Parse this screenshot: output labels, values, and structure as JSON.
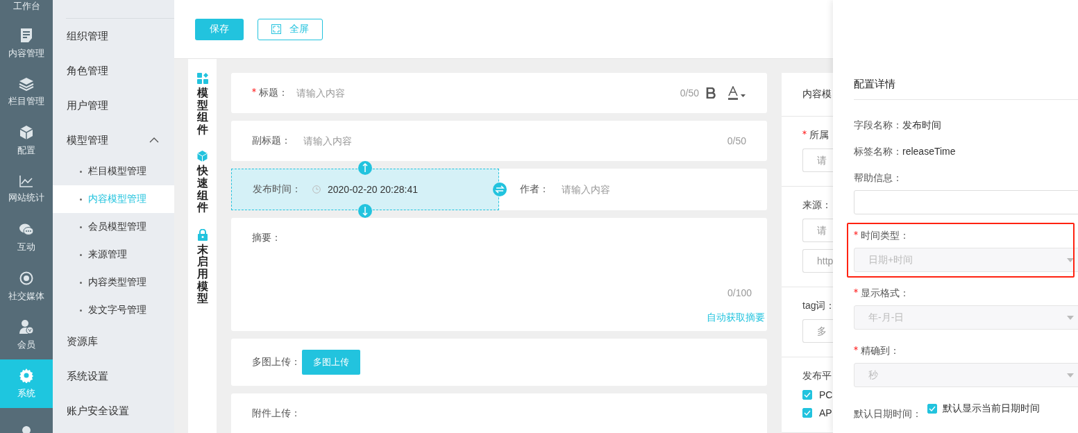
{
  "icon_bar": {
    "top_label": "工作台",
    "items": [
      {
        "kind": "doc",
        "label": "内容管理",
        "selected": false
      },
      {
        "kind": "layers",
        "label": "栏目管理",
        "selected": false
      },
      {
        "kind": "cube",
        "label": "配置",
        "selected": false
      },
      {
        "kind": "chart",
        "label": "网站统计",
        "selected": false
      },
      {
        "kind": "chat",
        "label": "互动",
        "selected": false
      },
      {
        "kind": "orbit",
        "label": "社交媒体",
        "selected": false
      },
      {
        "kind": "member",
        "label": "会员",
        "selected": false
      },
      {
        "kind": "gear",
        "label": "系统",
        "selected": true
      },
      {
        "kind": "support",
        "selected": false
      }
    ]
  },
  "submenu": [
    {
      "label": "组织管理"
    },
    {
      "label": "角色管理"
    },
    {
      "label": "用户管理"
    },
    {
      "label": "模型管理",
      "expanded": true,
      "children": [
        {
          "label": "栏目模型管理",
          "selected": false
        },
        {
          "label": "内容模型管理",
          "selected": true
        },
        {
          "label": "会员模型管理",
          "selected": false
        },
        {
          "label": "来源管理",
          "selected": false
        },
        {
          "label": "内容类型管理",
          "selected": false
        },
        {
          "label": "发文字号管理",
          "selected": false
        }
      ]
    },
    {
      "label": "资源库"
    },
    {
      "label": "系统设置"
    },
    {
      "label": "账户安全设置"
    }
  ],
  "toolbar": {
    "save": "保存",
    "fullscreen": "全屏"
  },
  "side_tabs": [
    {
      "kind": "grid",
      "label": "模型组件"
    },
    {
      "kind": "cube",
      "label": "快速组件"
    },
    {
      "kind": "lock",
      "label": "末启用模型"
    }
  ],
  "form": [
    {
      "kind": "title",
      "required": true,
      "label": "标题：",
      "placeholder": "请输入内容",
      "counter": "0/50"
    },
    {
      "kind": "text",
      "required": false,
      "label": "副标题：",
      "placeholder": "请输入内容",
      "counter": "0/50"
    },
    {
      "kind": "split",
      "fields": [
        {
          "label": "发布时间：",
          "value": "2020-02-20 20:28:41",
          "selected": true
        },
        {
          "label": "作者：",
          "placeholder": "请输入内容",
          "selected": false
        }
      ]
    },
    {
      "kind": "textarea",
      "required": false,
      "label": "摘要：",
      "counter": "0/100",
      "link": "自动获取摘要"
    },
    {
      "kind": "upload",
      "required": false,
      "label": "多图上传：",
      "button": "多图上传"
    },
    {
      "kind": "attach",
      "required": false,
      "label": "附件上传："
    }
  ],
  "right_panel": [
    {
      "kind": "heading",
      "label": "内容模"
    },
    {
      "kind": "field",
      "required": true,
      "label": "所属",
      "placeholders": [
        "请"
      ]
    },
    {
      "kind": "field",
      "required": false,
      "label": "来源：",
      "placeholders": [
        "请",
        "http"
      ]
    },
    {
      "kind": "field",
      "required": false,
      "label": "tag词：",
      "placeholders": [
        "多"
      ]
    },
    {
      "kind": "checks",
      "label": "发布平",
      "options": [
        {
          "label": "PC",
          "checked": true
        },
        {
          "label": "AP",
          "checked": true
        }
      ]
    }
  ],
  "drawer": {
    "title": "配置详情",
    "info": [
      {
        "label": "字段名称：",
        "value": "发布时间"
      },
      {
        "label": "标签名称：",
        "value": "releaseTime"
      }
    ],
    "help": {
      "label": "帮助信息："
    },
    "selects": [
      {
        "label": "时间类型：",
        "value": "日期+时间",
        "required": true,
        "disabled": true,
        "highlighted": true
      },
      {
        "label": "显示格式：",
        "value": "年-月-日",
        "required": true,
        "disabled": true,
        "highlighted": false
      },
      {
        "label": "精确到：",
        "value": "秒",
        "required": true,
        "disabled": true,
        "highlighted": false
      }
    ],
    "default": {
      "label": "默认日期时间：",
      "option": "默认显示当前日期时间",
      "checked": true
    }
  }
}
